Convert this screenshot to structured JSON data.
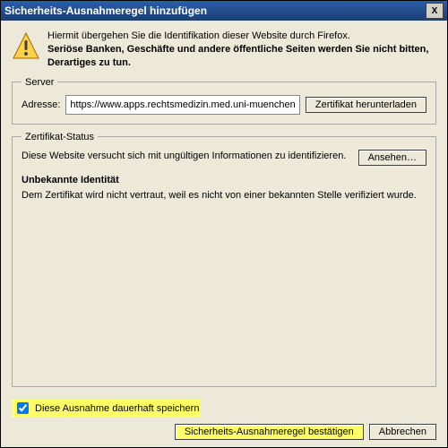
{
  "title": "Sicherheits-Ausnahmeregel hinzufügen",
  "close": "X",
  "intro": {
    "line1": "Hiermit übergehen Sie die Identifikation dieser Website durch Firefox.",
    "line2": "Seriöse Banken, Geschäfte und andere öffentliche Seiten werden Sie nicht bitten, Derartiges zu tun."
  },
  "server": {
    "legend": "Server",
    "addressLabel": "Adresse:",
    "addressValue": "https://www.apps.rechtsmedizin.med.uni-muenchen",
    "downloadBtn": "Zertifikat herunterladen"
  },
  "cert": {
    "legend": "Zertifikat-Status",
    "statusLine": "Diese Website versucht sich mit ungültigen Informationen zu identifizieren.",
    "viewBtn": "Ansehen…",
    "heading": "Unbekannte Identität",
    "detail": "Dem Zertifikat wird nicht vertraut, weil es nicht von einer bekannten Stelle verifiziert wurde."
  },
  "footer": {
    "checkboxLabel": "Diese Ausnahme dauerhaft speichern",
    "confirmBtn": "Sicherheits-Ausnahmeregel bestätigen",
    "cancelBtn": "Abbrechen"
  }
}
